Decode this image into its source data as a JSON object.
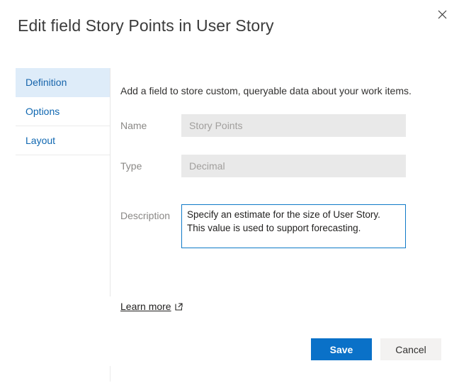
{
  "dialog": {
    "title": "Edit field Story Points in User Story",
    "close_icon": "close-icon",
    "close_label": "Close"
  },
  "pivot": {
    "items": [
      {
        "label": "Definition",
        "selected": true
      },
      {
        "label": "Options",
        "selected": false
      },
      {
        "label": "Layout",
        "selected": false
      }
    ]
  },
  "content": {
    "intro": "Add a field to store custom, queryable data about your work items.",
    "fields": [
      {
        "label": "Name",
        "value": "Story Points",
        "disabled": true
      },
      {
        "label": "Type",
        "value": "Decimal",
        "disabled": true
      }
    ],
    "description": {
      "label": "Description",
      "value": "Specify an estimate for the size of User Story. This value is used to support forecasting.",
      "placeholder": "",
      "focused": true
    },
    "learn_more": {
      "label": "Learn more",
      "icon": "external-link-icon"
    }
  },
  "footer": {
    "save_label": "Save",
    "cancel_label": "Cancel"
  },
  "colors": {
    "accent": "#0a71c8",
    "tab_selected_bg": "#deecf9",
    "tab_text": "#0f67b1",
    "focus_border": "#0f7ac8",
    "disabled_bg": "#e9e9e9",
    "disabled_text": "#a19f9d",
    "label_text": "#8a8886",
    "secondary_btn_bg": "#f3f2f1"
  }
}
